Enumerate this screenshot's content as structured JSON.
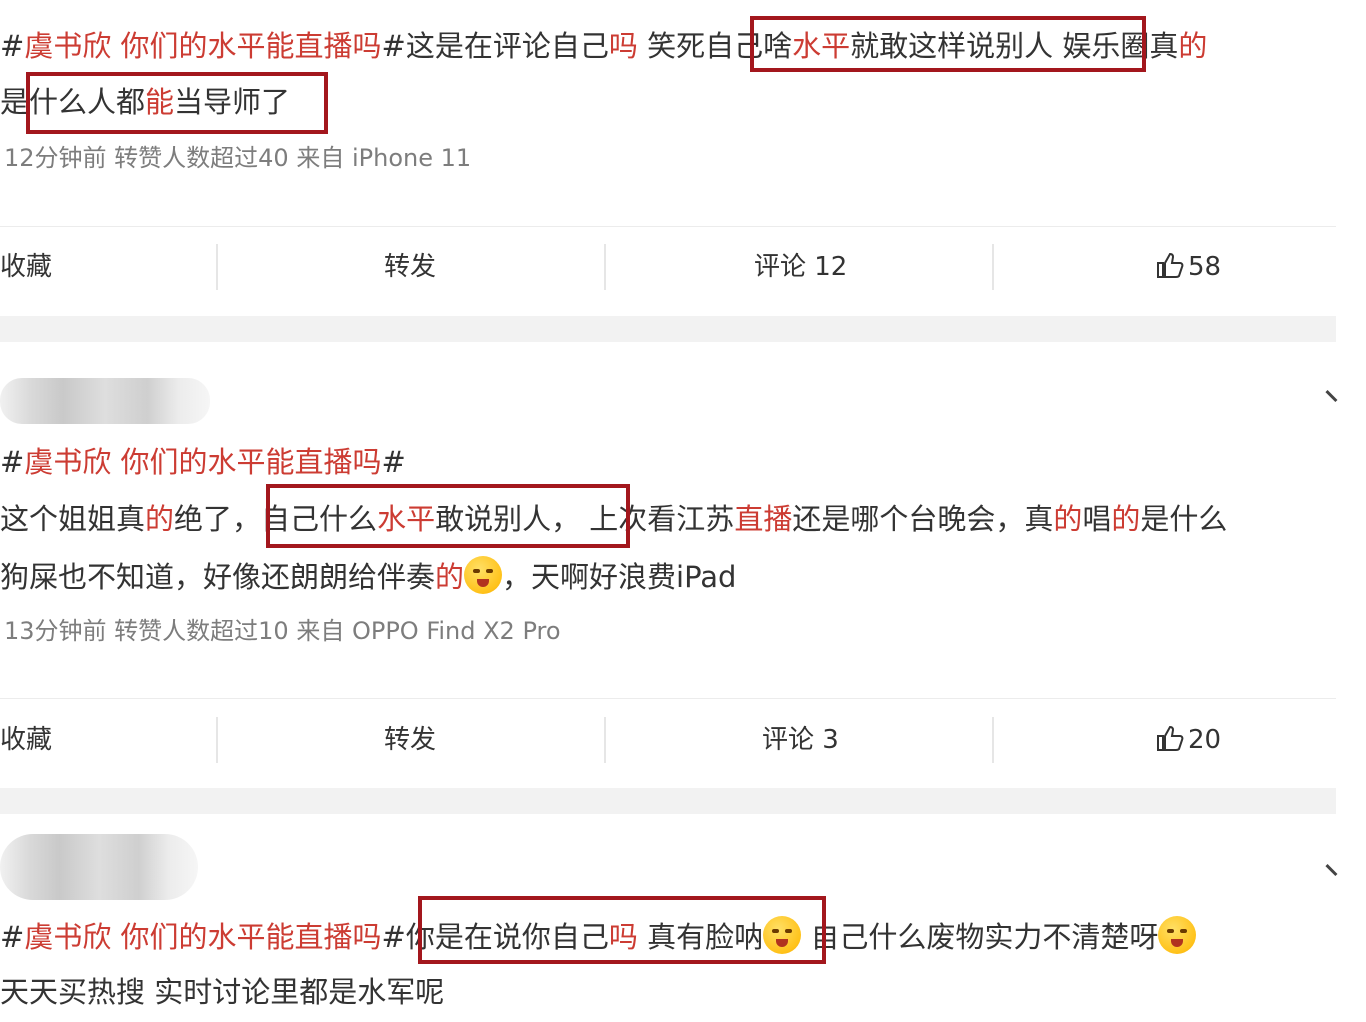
{
  "posts": [
    {
      "lines": [
        [
          {
            "t": "#",
            "h": false
          },
          {
            "t": "虞书欣 你们的水平能直播吗",
            "h": true
          },
          {
            "t": "#这是在评论自己",
            "h": false
          },
          {
            "t": "吗",
            "h": true
          },
          {
            "t": " 笑死",
            "h": false
          },
          {
            "t": "自己啥",
            "h": false
          },
          {
            "t": "水平",
            "h": true
          },
          {
            "t": "就敢这样说别人",
            "h": false
          },
          {
            "t": " 娱乐圈真",
            "h": false
          },
          {
            "t": "的",
            "h": true
          }
        ],
        [
          {
            "t": "是",
            "h": false
          },
          {
            "t": "什么人都",
            "h": false
          },
          {
            "t": "能",
            "h": true
          },
          {
            "t": "当导师了",
            "h": false
          }
        ]
      ],
      "meta": "12分钟前 转赞人数超过40  来自 iPhone 11",
      "actions": {
        "collect": "收藏",
        "forward": "转发",
        "comment": "评论 12",
        "likes": "58"
      }
    },
    {
      "lines": [
        [
          {
            "t": "#",
            "h": false
          },
          {
            "t": "虞书欣 你们的水平能直播吗",
            "h": true
          },
          {
            "t": "#",
            "h": false
          }
        ],
        [
          {
            "t": "这个姐姐真",
            "h": false
          },
          {
            "t": "的",
            "h": true
          },
          {
            "t": "绝了，",
            "h": false
          },
          {
            "t": "自己什么",
            "h": false
          },
          {
            "t": "水平",
            "h": true
          },
          {
            "t": "敢说别人，",
            "h": false
          },
          {
            "t": " 上次看江苏",
            "h": false
          },
          {
            "t": "直播",
            "h": true
          },
          {
            "t": "还是哪个台晚会，真",
            "h": false
          },
          {
            "t": "的",
            "h": true
          },
          {
            "t": "唱",
            "h": false
          },
          {
            "t": "的",
            "h": true
          },
          {
            "t": "是什么",
            "h": false
          }
        ],
        [
          {
            "t": "狗屎也不知道，好像还朗朗给伴奏",
            "h": false
          },
          {
            "t": "的",
            "h": true
          },
          {
            "t": "EMOJI",
            "h": false
          },
          {
            "t": "，天啊好浪费iPad",
            "h": false
          }
        ]
      ],
      "meta": "13分钟前 转赞人数超过10  来自 OPPO Find X2 Pro",
      "actions": {
        "collect": "收藏",
        "forward": "转发",
        "comment": "评论 3",
        "likes": "20"
      }
    },
    {
      "lines": [
        [
          {
            "t": "#",
            "h": false
          },
          {
            "t": "虞书欣 你们的水平能直播吗",
            "h": true
          },
          {
            "t": "#",
            "h": false
          },
          {
            "t": "你是在说你自己",
            "h": false
          },
          {
            "t": "吗",
            "h": true
          },
          {
            "t": " 真有脸呐",
            "h": false
          },
          {
            "t": "EMOJI",
            "h": false
          },
          {
            "t": " 自己什么废物实力不清楚呀",
            "h": false
          },
          {
            "t": "EMOJI",
            "h": false
          }
        ],
        [
          {
            "t": "天天买热搜 实时讨论里都是水军呢",
            "h": false
          }
        ]
      ]
    }
  ],
  "colors": {
    "highlight": "#cc3c33",
    "box": "#a3171d",
    "meta": "#7d7d7d"
  },
  "icons": {
    "like": "thumbs-up-icon",
    "chevron": "chevron-down-icon",
    "emoji": "smiley-emoji-icon"
  }
}
